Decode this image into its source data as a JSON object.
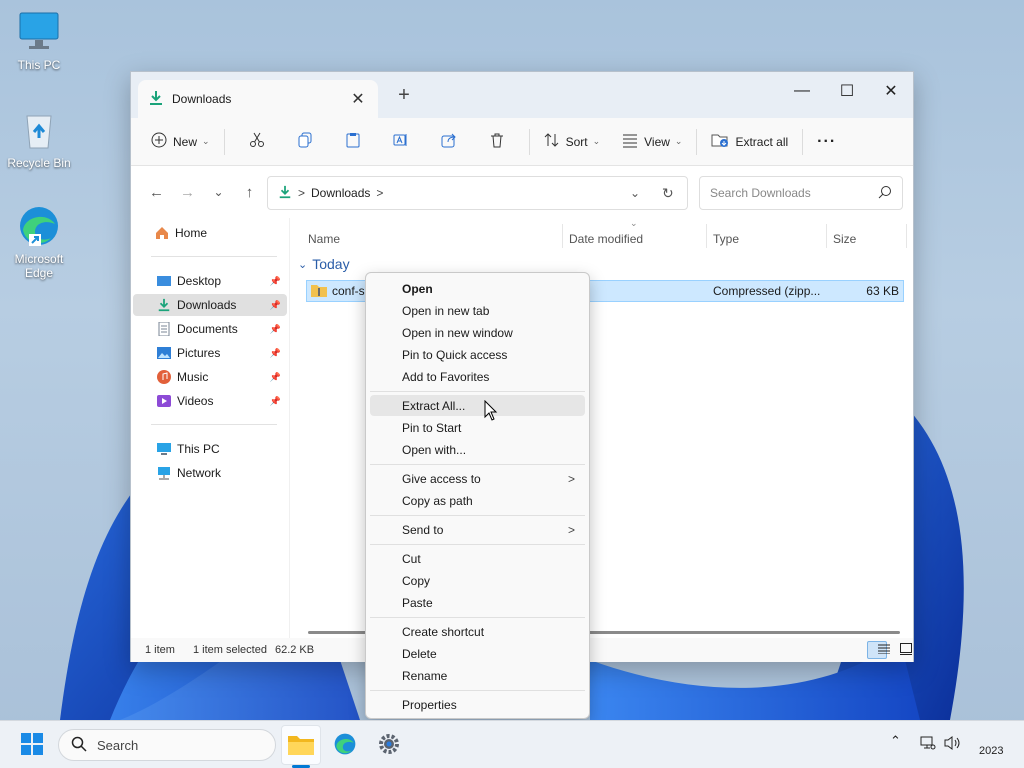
{
  "desktop": {
    "icons": [
      {
        "label": "This PC",
        "icon": "monitor-icon"
      },
      {
        "label": "Recycle Bin",
        "icon": "recycle-bin-icon"
      },
      {
        "label": "Microsoft Edge",
        "icon": "edge-icon"
      }
    ]
  },
  "window": {
    "tab_title": "Downloads",
    "controls": {
      "minimize": "—",
      "maximize": "☐",
      "close": "✕"
    },
    "new_tab": "+"
  },
  "toolbar": {
    "new_label": "New",
    "sort_label": "Sort",
    "view_label": "View",
    "extract_all_label": "Extract all",
    "more_label": "···"
  },
  "address": {
    "crumb": "Downloads",
    "separator": ">",
    "search_placeholder": "Search Downloads"
  },
  "nav": {
    "home": "Home",
    "quick": [
      {
        "label": "Desktop",
        "color": "#3a8dde"
      },
      {
        "label": "Downloads",
        "color": "#1aa37a"
      },
      {
        "label": "Documents",
        "color": "#7a8594"
      },
      {
        "label": "Pictures",
        "color": "#2f7fd6"
      },
      {
        "label": "Music",
        "color": "#e2603a"
      },
      {
        "label": "Videos",
        "color": "#8d4bd6"
      }
    ],
    "this_pc": "This PC",
    "network": "Network"
  },
  "columns": {
    "name": "Name",
    "date": "Date modified",
    "type": "Type",
    "size": "Size"
  },
  "group_label": "Today",
  "file": {
    "name": "conf-sz",
    "type": "Compressed (zipp...",
    "size": "63 KB"
  },
  "status": {
    "items": "1 item",
    "selected": "1 item selected",
    "size": "62.2 KB"
  },
  "context_menu": {
    "groups": [
      [
        "Open",
        "Open in new tab",
        "Open in new window",
        "Pin to Quick access",
        "Add to Favorites"
      ],
      [
        "Extract All...",
        "Pin to Start",
        "Open with..."
      ],
      [
        "Give access to",
        "Copy as path"
      ],
      [
        "Send to"
      ],
      [
        "Cut",
        "Copy",
        "Paste"
      ],
      [
        "Create shortcut",
        "Delete",
        "Rename"
      ],
      [
        "Properties"
      ]
    ],
    "submenu_arrow": ">"
  },
  "taskbar": {
    "search_placeholder": "Search",
    "clock": "2023"
  },
  "colors": {
    "accent": "#0078d4",
    "selection": "#cde8ff",
    "group": "#2a5da8"
  }
}
